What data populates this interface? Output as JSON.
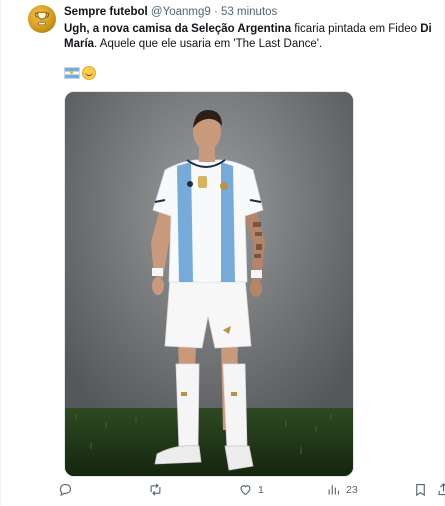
{
  "tweet": {
    "author_name": "Sempre futebol",
    "author_handle": "@Yoanmg9",
    "separator": "·",
    "time": "53 minutos",
    "text_bold_1": "Ugh, a nova camisa da Seleção Argentina",
    "text_1": " ficaria pintada em Fideo ",
    "text_bold_2": "Di María",
    "text_2": ". Aquele que ele usaria em 'The Last Dance'.",
    "emojis": [
      "argentina-flag",
      "smiling-face"
    ]
  },
  "actions": {
    "reply_count": "",
    "retweet_count": "",
    "like_count": "1",
    "views_count": "23"
  },
  "colors": {
    "text": "#0f1419",
    "secondary": "#536471",
    "jersey_blue": "#75aadb",
    "background_grey": "#7c7f81",
    "turf_green": "#1e3a1a"
  }
}
